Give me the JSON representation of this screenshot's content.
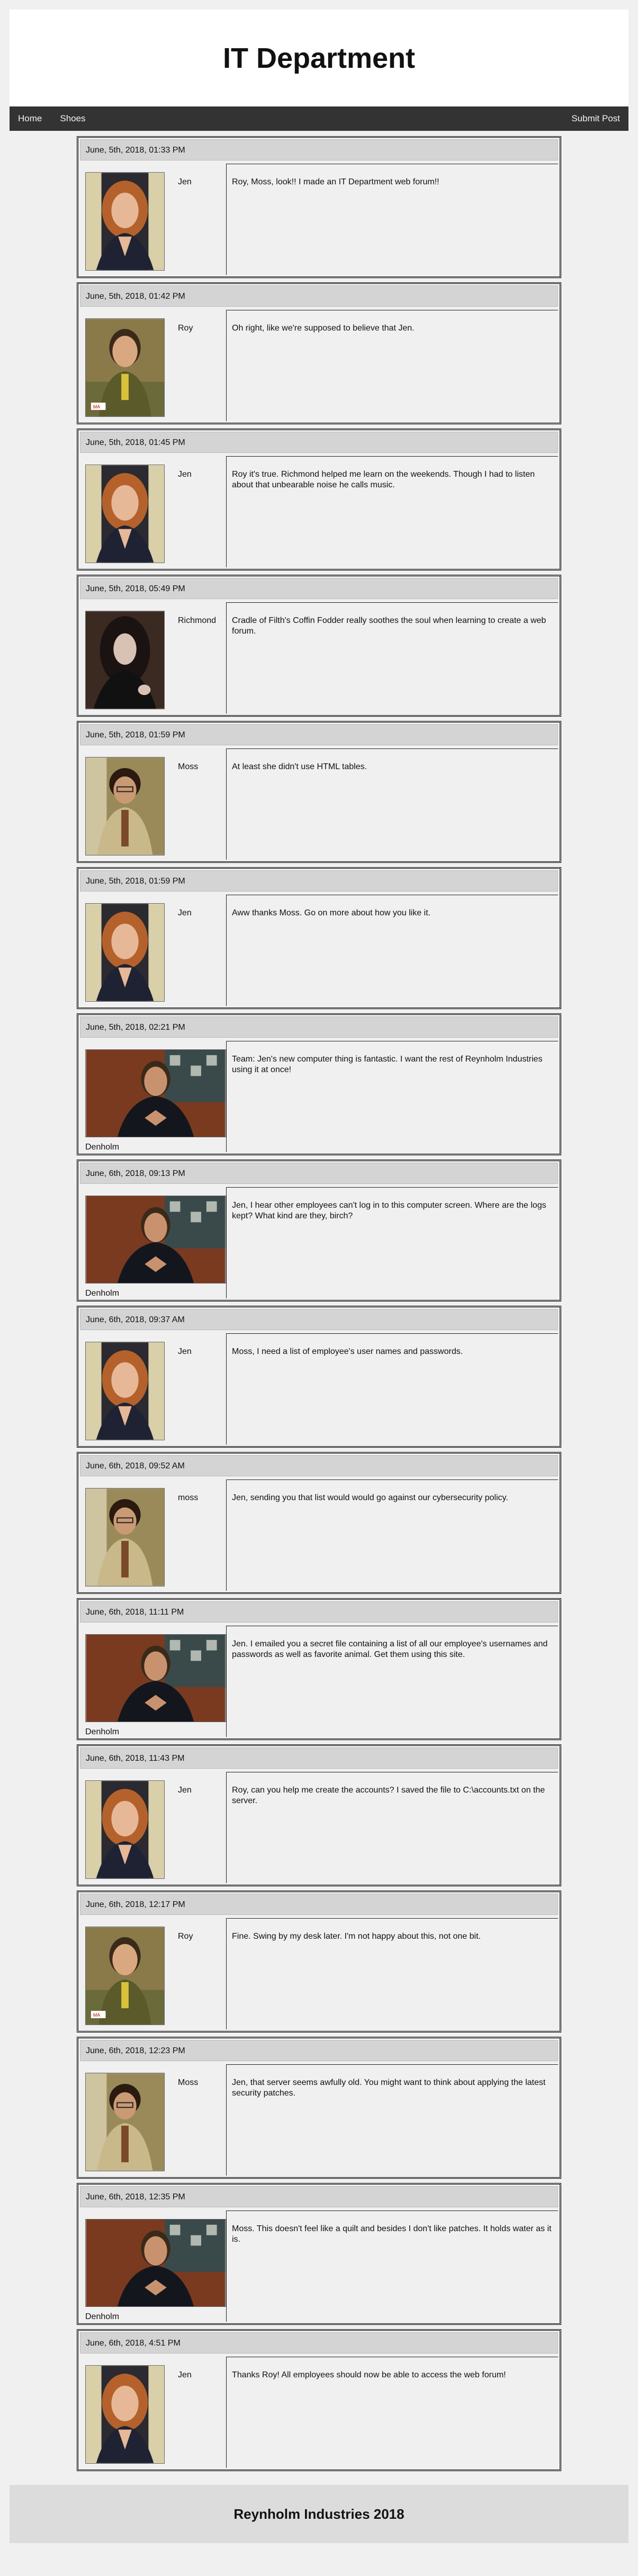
{
  "header": {
    "title": "IT Department"
  },
  "nav": {
    "home": "Home",
    "shoes": "Shoes",
    "submit": "Submit Post"
  },
  "colors": {
    "navbar": "#333333",
    "header_bg": "#ffffff",
    "post_head_bg": "#d4d4d4",
    "page_bg": "#f0f0f0"
  },
  "posts": [
    {
      "date": "June, 5th, 2018, 01:33 PM",
      "user": "Jen",
      "avatar": "jen",
      "message": "Roy, Moss, look!! I made an IT Department web forum!!"
    },
    {
      "date": "June, 5th, 2018, 01:42 PM",
      "user": "Roy",
      "avatar": "roy",
      "message": "Oh right, like we're supposed to believe that Jen."
    },
    {
      "date": "June, 5th, 2018, 01:45 PM",
      "user": "Jen",
      "avatar": "jen",
      "message": "Roy it's true. Richmond helped me learn on the weekends. Though I had to listen about that unbearable noise he calls music."
    },
    {
      "date": "June, 5th, 2018, 05:49 PM",
      "user": "Richmond",
      "avatar": "richmond",
      "message": "Cradle of Filth's Coffin Fodder really soothes the soul when learning to create a web forum."
    },
    {
      "date": "June, 5th, 2018, 01:59 PM",
      "user": "Moss",
      "avatar": "moss",
      "message": "At least she didn't use HTML tables."
    },
    {
      "date": "June, 5th, 2018, 01:59 PM",
      "user": "Jen",
      "avatar": "jen",
      "message": "Aww thanks Moss. Go on more about how you like it."
    },
    {
      "date": "June, 5th, 2018, 02:21 PM",
      "user": "Denholm",
      "avatar": "denholm",
      "message": "Team: Jen's new computer thing is fantastic. I want the rest of Reynholm Industries using it at once!"
    },
    {
      "date": "June, 6th, 2018, 09:13 PM",
      "user": "Denholm",
      "avatar": "denholm",
      "message": "Jen, I hear other employees can't log in to this computer screen. Where are the logs kept? What kind are they, birch?"
    },
    {
      "date": "June, 6th, 2018, 09:37 AM",
      "user": "Jen",
      "avatar": "jen",
      "message": "Moss, I need a list of employee's user names and passwords."
    },
    {
      "date": "June, 6th, 2018, 09:52 AM",
      "user": "moss",
      "avatar": "moss",
      "message": "Jen, sending you that list would would go against our cybersecurity policy."
    },
    {
      "date": "June, 6th, 2018, 11:11 PM",
      "user": "Denholm",
      "avatar": "denholm",
      "message": "Jen. I emailed you a secret file containing a list of all our employee's usernames and passwords as well as favorite animal. Get them using this site."
    },
    {
      "date": "June, 6th, 2018, 11:43 PM",
      "user": "Jen",
      "avatar": "jen",
      "message": "Roy, can you help me create the accounts? I saved the file to C:\\accounts.txt on the server."
    },
    {
      "date": "June, 6th, 2018, 12:17 PM",
      "user": "Roy",
      "avatar": "roy",
      "message": "Fine. Swing by my desk later. I'm not happy about this, not one bit."
    },
    {
      "date": "June, 6th, 2018, 12:23 PM",
      "user": "Moss",
      "avatar": "moss",
      "message": "Jen, that server seems awfully old. You might want to think about applying the latest security patches."
    },
    {
      "date": "June, 6th, 2018, 12:35 PM",
      "user": "Denholm",
      "avatar": "denholm",
      "message": "Moss. This doesn't feel like a quilt and besides I don't like patches. It holds water as it is."
    },
    {
      "date": "June, 6th, 2018, 4:51 PM",
      "user": "Jen",
      "avatar": "jen",
      "message": "Thanks Roy! All employees should now be able to access the web forum!"
    }
  ],
  "footer": {
    "text": "Reynholm Industries 2018"
  }
}
